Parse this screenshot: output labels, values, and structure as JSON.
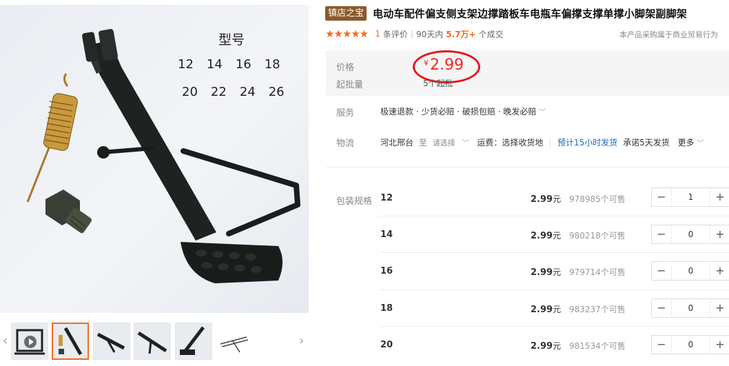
{
  "gallery": {
    "model_title": "型号",
    "model_row1": [
      "12",
      "14",
      "16",
      "18"
    ],
    "model_row2": [
      "20",
      "22",
      "24",
      "26"
    ],
    "prev_label": "‹",
    "next_label": "›",
    "thumbnails": [
      "video-thumbnail",
      "kickstand-kit",
      "kickstand-side",
      "kickstand-angle",
      "kickstand-foot",
      "kickstand-line-drawing"
    ]
  },
  "product": {
    "badge": "镇店之宝",
    "title": "电动车配件偏支侧支架边撑踏板车电瓶车偏撑支撑单撑小脚架副脚架",
    "stars": "★★★★★",
    "review_count": "1",
    "review_label": "条评价",
    "sales_period": "90天内",
    "sales_count": "5.7万+",
    "sales_suffix": "个成交",
    "purchase_note": "本产品采购属于商业贸易行为"
  },
  "price": {
    "label": "价格",
    "currency": "¥",
    "value": "2.99",
    "moq_label": "起批量",
    "moq_value": "5个起批"
  },
  "service": {
    "label": "服务",
    "text": "极速退款 · 少货必赔 · 破损包赔 · 晚发必赔"
  },
  "logistics": {
    "label": "物流",
    "origin": "河北邢台",
    "to": "至",
    "select": "请选择",
    "fee": "运费：选择收货地",
    "eta": "预计15小时发货",
    "promise": "承诺5天发货",
    "more": "更多"
  },
  "sku": {
    "label": "包装规格",
    "rows": [
      {
        "name": "12",
        "price": "2.99",
        "unit": "元",
        "stock": "978985个可售",
        "qty": "1"
      },
      {
        "name": "14",
        "price": "2.99",
        "unit": "元",
        "stock": "980218个可售",
        "qty": "0"
      },
      {
        "name": "16",
        "price": "2.99",
        "unit": "元",
        "stock": "979714个可售",
        "qty": "0"
      },
      {
        "name": "18",
        "price": "2.99",
        "unit": "元",
        "stock": "983237个可售",
        "qty": "0"
      },
      {
        "name": "20",
        "price": "2.99",
        "unit": "元",
        "stock": "981534个可售",
        "qty": "0"
      }
    ]
  },
  "colors": {
    "accent": "#f36a1c",
    "price_red": "#f42424",
    "badge_brown": "#8b5a2b",
    "link_blue": "#1c66b7"
  }
}
